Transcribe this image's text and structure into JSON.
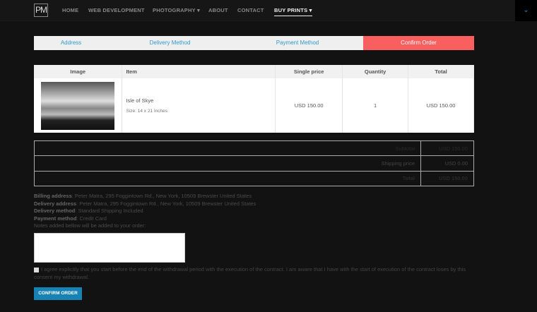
{
  "header": {
    "logo": "PM",
    "nav": [
      "HOME",
      "WEB DEVELOPMENT",
      "PHOTOGRAPHY ▾",
      "ABOUT",
      "CONTACT",
      "BUY PRINTS ▾"
    ],
    "toggle_icon": "chevron-down-icon"
  },
  "steps": [
    "Address",
    "Delivery Method",
    "Payment Method",
    "Confirm Order"
  ],
  "items_table": {
    "headers": [
      "Image",
      "Item",
      "Single price",
      "Quantity",
      "Total"
    ],
    "rows": [
      {
        "name": "Isle of Skye",
        "size": "Size: 14 x 21 Inches",
        "single_price": "USD 150.00",
        "quantity": "1",
        "total": "USD 150.00"
      }
    ]
  },
  "summary": [
    {
      "label": "Subtotal",
      "value": "USD 150.00"
    },
    {
      "label": "Shipping price",
      "value": "USD 0.00"
    },
    {
      "label": "Total",
      "value": "USD 150.00"
    }
  ],
  "info": {
    "billing_label": "Billing address",
    "billing": ": Peter Matra, 295 Foggintown Rd., New York, 10509 Brewster United States",
    "delivery_label": "Delivery address",
    "delivery": ": Peter Matra, 295 Foggintown Rd., New York, 10509 Brewster United States",
    "method_label": "Delivery method",
    "method": ": Standard Shipping Included",
    "payment_label": "Payment method",
    "payment": ": Credit Card",
    "notes": "Notes added bellow will be added to your order:"
  },
  "agree_text": "I agree explicitly that you start before the end of the withdrawal period with the execution of the contract. I am aware that I have with the start of execution of the contract loses by this consent my withdrawal.",
  "confirm_button": "CONFIRM ORDER",
  "colors": {
    "accent": "#1783b5",
    "active_step": "#f95f5f",
    "link": "#2e9acb"
  }
}
